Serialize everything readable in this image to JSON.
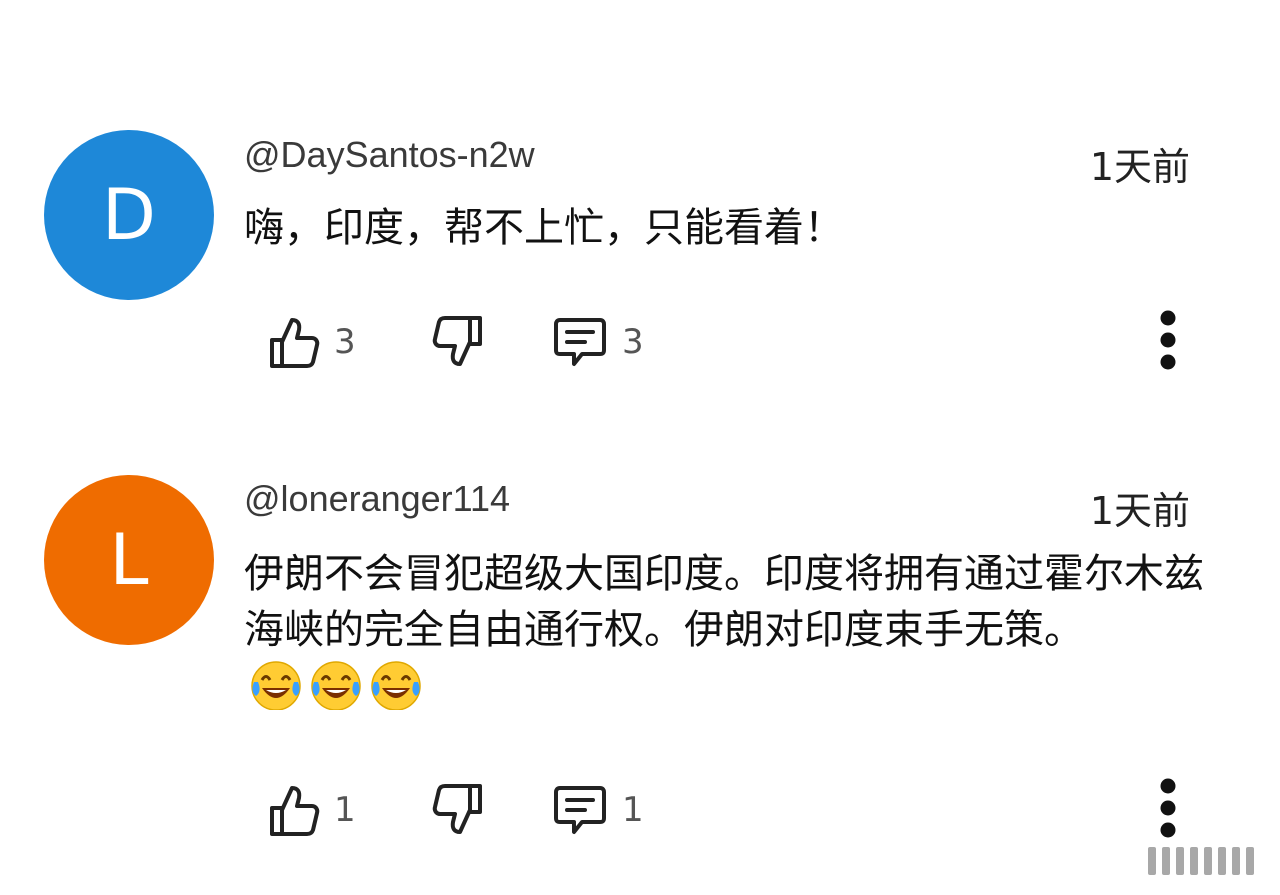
{
  "comments": [
    {
      "avatar_letter": "D",
      "avatar_color": "#1e88d8",
      "handle": "@DaySantos-n2w",
      "time": "1天前",
      "text": "嗨，印度，帮不上忙，只能看着！",
      "likes": "3",
      "replies": "3"
    },
    {
      "avatar_letter": "L",
      "avatar_color": "#ef6c00",
      "handle": "@loneranger114",
      "time": "1天前",
      "text": "伊朗不会冒犯超级大国印度。印度将拥有通过霍尔木兹海峡的完全自由通行权。伊朗对印度束手无策。",
      "emoji": "face-with-tears-of-joy ×3",
      "likes": "1",
      "replies": "1"
    }
  ],
  "icons": {
    "like": "thumbs-up-icon",
    "dislike": "thumbs-down-icon",
    "reply": "comment-icon",
    "more": "more-vertical-icon"
  }
}
